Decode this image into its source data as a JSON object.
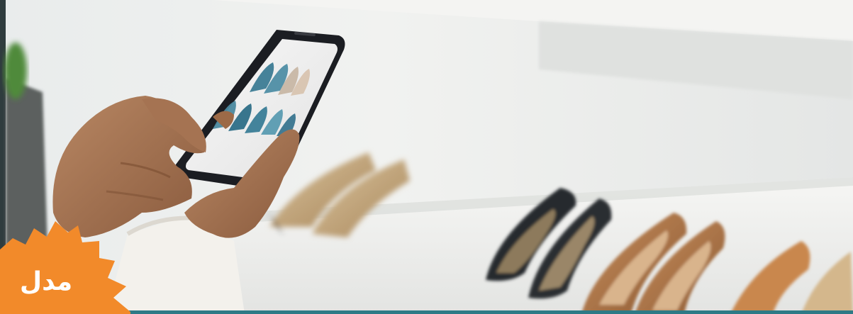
{
  "badge": {
    "label": "مدل",
    "color": "#F28A2A"
  },
  "frame_color": "#2E7A86",
  "icons": [
    "smartphone-icon"
  ]
}
